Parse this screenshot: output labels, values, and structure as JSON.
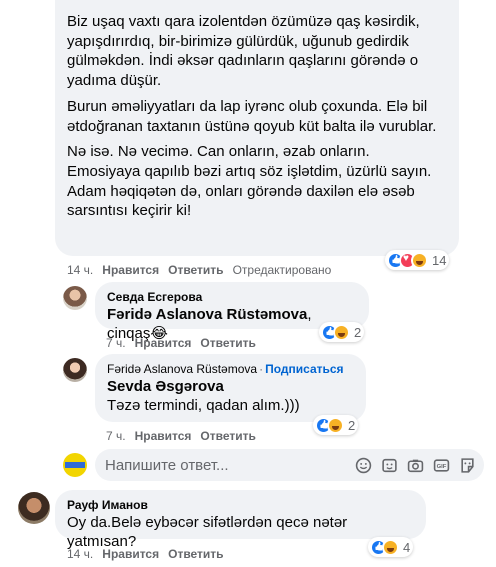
{
  "main_comment": {
    "paragraphs": [
      "Biz uşaq vaxtı qara izolentdən özümüzə qaş kəsirdik, yapışdırırdıq, bir-birimizə gülürdük, uğunub gedirdik gülməkdən. İndi əksər qadınların qaşlarını görəndə o yadıma düşür.",
      "Burun əməliyyatları da lap iyrənc olub çoxunda. Elə bil ətdoğranan taxtanın üstünə qoyub küt balta ilə vurublar.",
      "Nə isə. Nə vecimə. Can onların, əzab onların. Emosiyaya qapılıb bəzi artıq söz işlətdim, üzürlü sayın. Adam həqiqətən də, onları görəndə daxilən elə əsəb sarsıntısı keçirir ki!"
    ],
    "time": "14 ч.",
    "like": "Нравится",
    "reply": "Ответить",
    "edited": "Отредактировано",
    "reaction_count": "14"
  },
  "reply1": {
    "author": "Севда Есгерова",
    "mention": "Fəridə Aslanova Rüstəmova",
    "text": ", cinqaş😂",
    "time": "7 ч.",
    "like": "Нравится",
    "reply": "Ответить",
    "reaction_count": "2"
  },
  "reply2": {
    "author": "Fəridə Aslanova Rüstəmova",
    "dot": "·",
    "follow": "Подписаться",
    "mention": "Sevda Əsgərova",
    "text": "Təzə termindi, qadan alım.)))",
    "time": "7 ч.",
    "like": "Нравится",
    "reply": "Ответить",
    "reaction_count": "2"
  },
  "composer": {
    "placeholder": "Напишите ответ...",
    "icons": [
      "sticker-icon",
      "emoji-icon",
      "camera-icon",
      "gif-icon",
      "sticker-sheet-icon"
    ]
  },
  "comment2": {
    "author": "Рауф Иманов",
    "text": "Oy da.Belə eybəcər sifətlərdən qecə nətər yatmısan?",
    "time": "14 ч.",
    "like": "Нравится",
    "reply": "Ответить",
    "reaction_count": "4"
  },
  "colors": {
    "link": "#0064d1",
    "meta": "#65676b",
    "bubble": "#f0f2f5",
    "like": "#1877f2",
    "love": "#f33e58",
    "haha": "#f7b125"
  }
}
